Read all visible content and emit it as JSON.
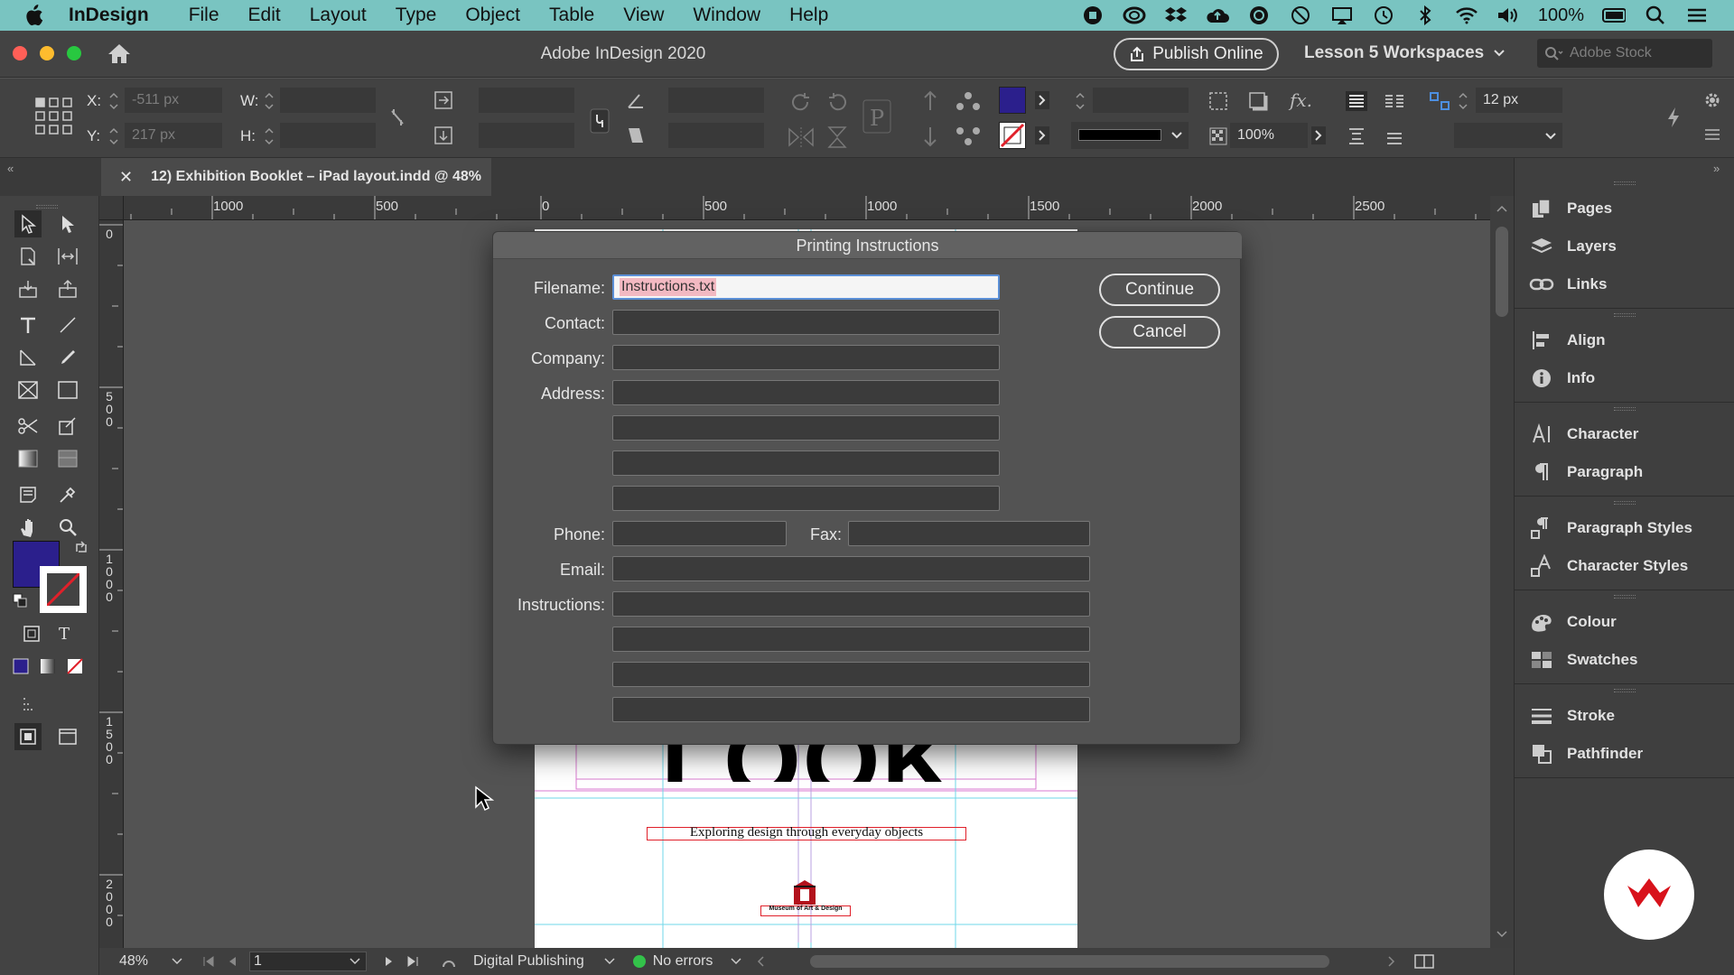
{
  "menubar": {
    "app_name": "InDesign",
    "items": [
      "File",
      "Edit",
      "Layout",
      "Type",
      "Object",
      "Table",
      "View",
      "Window",
      "Help"
    ],
    "battery": "100%"
  },
  "titlebar": {
    "title": "Adobe InDesign 2020",
    "publish_label": "Publish Online",
    "workspace_label": "Lesson 5 Workspaces",
    "stock_placeholder": "Adobe Stock"
  },
  "control": {
    "x_label": "X:",
    "y_label": "Y:",
    "w_label": "W:",
    "h_label": "H:",
    "x_value": "-511 px",
    "y_value": "217 px",
    "scale_value": "100%",
    "gutter_value": "12 px",
    "fill_color": "#2b1f8c"
  },
  "document": {
    "tab_title": "12) Exhibition Booklet – iPad layout.indd @ 48%",
    "headline_fragment": "LOOK",
    "subtitle": "Exploring design through everyday objects",
    "museum_label": "Museum of Art & Design"
  },
  "rulers": {
    "h_labels": [
      "1000",
      "500",
      "0",
      "500",
      "1000",
      "1500",
      "2000",
      "2500"
    ],
    "v_labels": [
      "0",
      "500",
      "1000",
      "1500",
      "2000"
    ]
  },
  "statusbar": {
    "zoom": "48%",
    "page": "1",
    "intent": "Digital Publishing",
    "preflight": "No errors"
  },
  "panels": {
    "items": [
      "Pages",
      "Layers",
      "Links",
      "Align",
      "Info",
      "Character",
      "Paragraph",
      "Paragraph Styles",
      "Character Styles",
      "Colour",
      "Swatches",
      "Stroke",
      "Pathfinder"
    ]
  },
  "dialog": {
    "title": "Printing Instructions",
    "filename_label": "Filename:",
    "filename_value": "Instructions.txt",
    "contact_label": "Contact:",
    "company_label": "Company:",
    "address_label": "Address:",
    "phone_label": "Phone:",
    "fax_label": "Fax:",
    "email_label": "Email:",
    "instructions_label": "Instructions:",
    "continue_label": "Continue",
    "cancel_label": "Cancel"
  }
}
